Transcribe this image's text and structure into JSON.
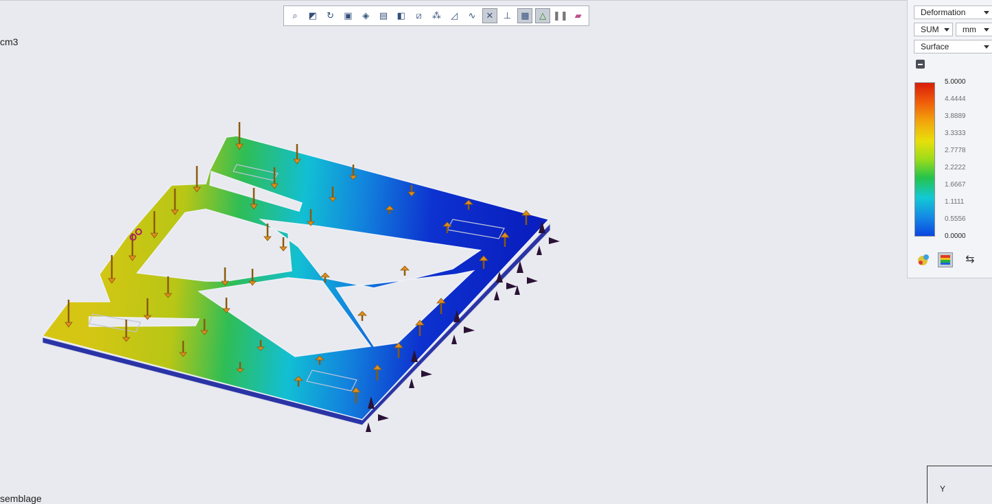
{
  "toolbar": {
    "icons": [
      "zoom-fit-icon",
      "zoom-area-icon",
      "rotate-view-icon",
      "cube-view-icon",
      "view-orientation-icon",
      "camera-icon",
      "section-view-icon",
      "display-style-icon",
      "hide-show-icon",
      "scene-icon",
      "plot-icon",
      "show-loads-icon",
      "show-fixtures-icon",
      "deformed-shape-icon",
      "plot-options-icon",
      "pause-icon",
      "color-chart-icon"
    ]
  },
  "overlay": {
    "top_left_text": "cm3",
    "bottom_left_text": "semblage"
  },
  "panel": {
    "result_type": "Deformation",
    "component": "SUM",
    "units": "mm",
    "display": "Surface",
    "legend": [
      "5.0000",
      "4.4444",
      "3.8889",
      "3.3333",
      "2.7778",
      "2.2222",
      "1.6667",
      "1.1111",
      "0.5556",
      "0.0000"
    ]
  },
  "triad": {
    "y_label": "Y"
  },
  "colors": {
    "max": "#d81e0a",
    "mid": "#e8df0c",
    "min": "#0b46e0",
    "background": "#e9eaef"
  }
}
